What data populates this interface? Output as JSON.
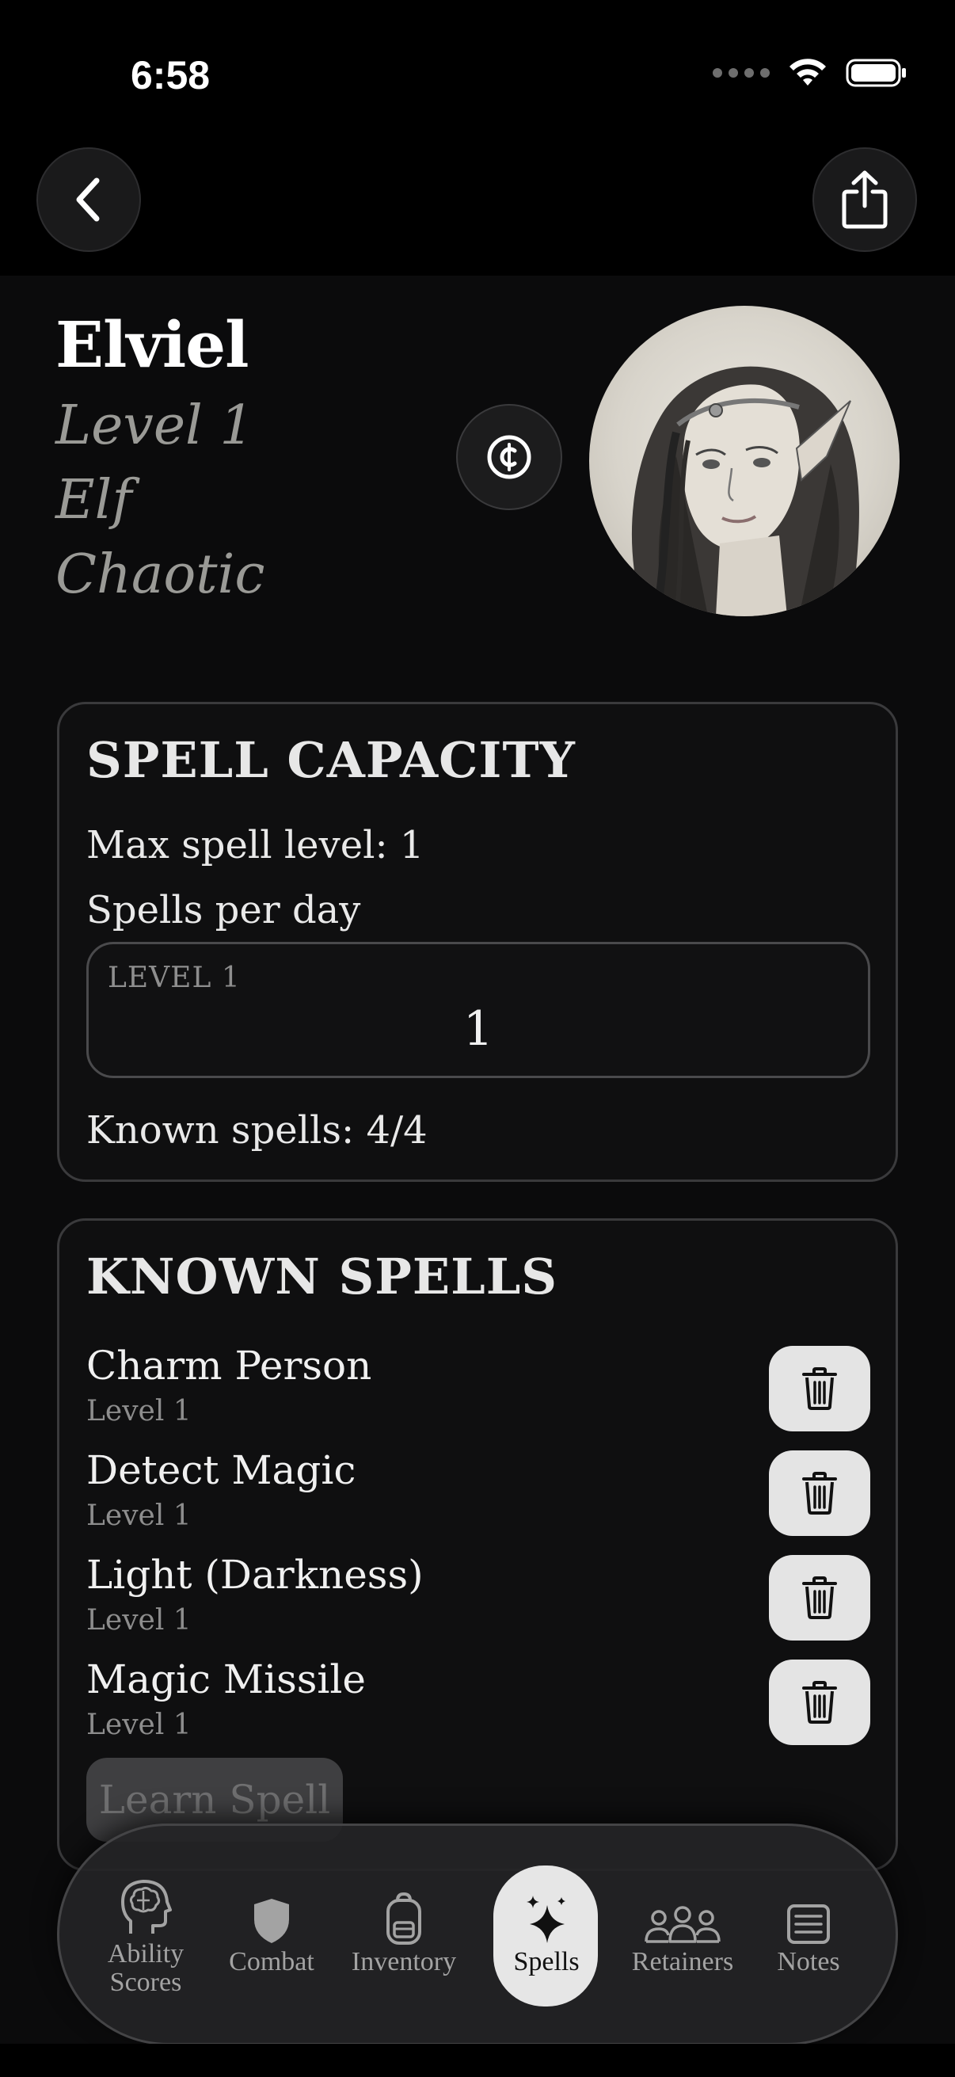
{
  "status_bar": {
    "time": "6:58"
  },
  "nav": {
    "back_icon": "chevron-left-icon",
    "share_icon": "share-icon"
  },
  "character": {
    "name": "Elviel",
    "level": "Level 1",
    "race": "Elf",
    "alignment": "Chaotic",
    "currency_icon": "coin-icon"
  },
  "spell_capacity": {
    "title": "SPELL CAPACITY",
    "max_spell_level": "Max spell level: 1",
    "spells_per_day_label": "Spells per day",
    "level_box_label": "LEVEL 1",
    "level_box_value": "1",
    "known_spells": "Known spells: 4/4"
  },
  "known_spells": {
    "title": "KNOWN SPELLS",
    "spells": [
      {
        "name": "Charm Person",
        "level": "Level 1"
      },
      {
        "name": "Detect Magic",
        "level": "Level 1"
      },
      {
        "name": "Light (Darkness)",
        "level": "Level 1"
      },
      {
        "name": "Magic Missile",
        "level": "Level 1"
      }
    ],
    "learn_button": "Learn Spell"
  },
  "tabs": [
    {
      "label": "Ability Scores",
      "line1": "Ability",
      "line2": "Scores",
      "icon": "brain-head-icon"
    },
    {
      "label": "Combat",
      "icon": "shield-icon"
    },
    {
      "label": "Inventory",
      "icon": "backpack-icon"
    },
    {
      "label": "Spells",
      "icon": "sparkles-icon",
      "active": true
    },
    {
      "label": "Retainers",
      "icon": "people-icon"
    },
    {
      "label": "Notes",
      "icon": "notes-icon"
    }
  ]
}
